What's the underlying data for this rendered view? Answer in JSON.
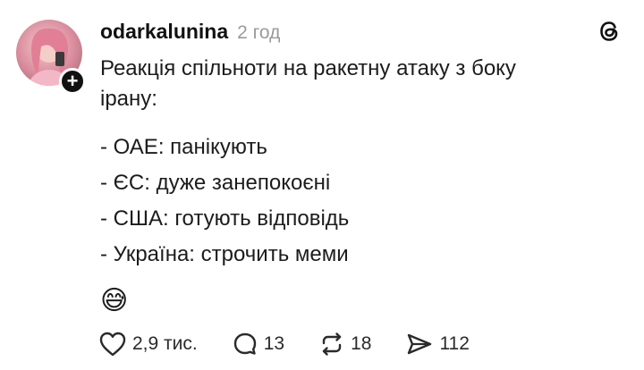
{
  "post": {
    "username": "odarkalunina",
    "timestamp": "2 год",
    "intro_line1": "Реакція спільноти на ракетну атаку з боку",
    "intro_line2": "ірану:",
    "list": [
      "- ОАЕ: панікують",
      "- ЄС: дуже занепокоєні",
      "- США: готують відповідь",
      "- Україна: строчить меми"
    ],
    "emoji": "😅"
  },
  "actions": {
    "likes": "2,9 тис.",
    "replies": "13",
    "reposts": "18",
    "shares": "112"
  },
  "icons": {
    "avatar": "avatar",
    "follow": "plus-icon",
    "app": "threads-logo-icon",
    "like": "heart-icon",
    "reply": "comment-icon",
    "repost": "repost-icon",
    "share": "send-icon"
  }
}
